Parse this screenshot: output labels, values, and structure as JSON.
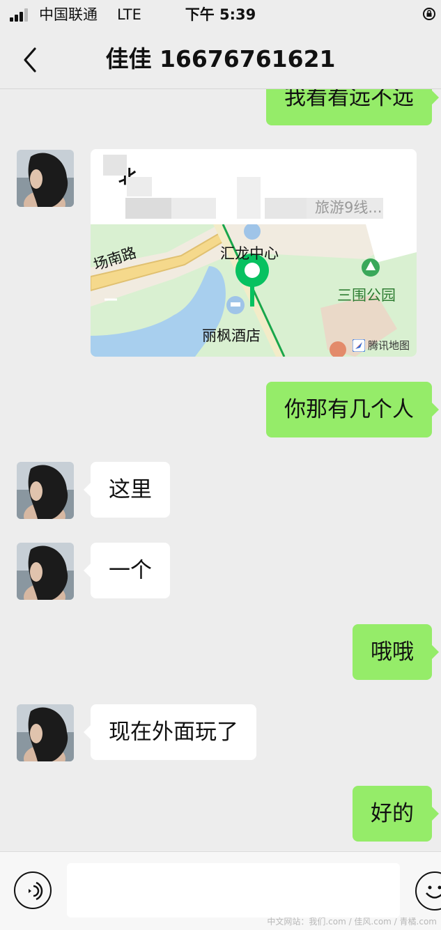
{
  "status_bar": {
    "carrier": "中国联通",
    "network": "LTE",
    "time": "下午 5:39"
  },
  "header": {
    "title": "佳佳 16676761621",
    "back_icon": "chevron-left-icon"
  },
  "messages": {
    "m1": {
      "side": "out",
      "text": "我看看远不远"
    },
    "location": {
      "side": "in",
      "title_visible": "北",
      "subtitle_visible": "旅游9线...",
      "map": {
        "labels": {
          "road": "场南路",
          "center": "汇龙中心",
          "park": "三围公园",
          "hotel": "丽枫酒店"
        },
        "attribution": "腾讯地图",
        "pin_color": "#07c160"
      }
    },
    "m3": {
      "side": "out",
      "text": "你那有几个人"
    },
    "m4": {
      "side": "in",
      "text": "这里"
    },
    "m5": {
      "side": "in",
      "text": "一个"
    },
    "m6": {
      "side": "out",
      "text": "哦哦"
    },
    "m7": {
      "side": "in",
      "text": "现在外面玩了"
    },
    "m8": {
      "side": "out",
      "text": "好的"
    }
  },
  "input_bar": {
    "voice_icon": "voice-icon",
    "emoji_icon": "emoji-icon",
    "message_value": ""
  },
  "watermark": "中文网站：我们.com / 佳风.com / 青橘.com",
  "colors": {
    "outgoing_bubble": "#95ec69",
    "incoming_bubble": "#ffffff",
    "background": "#ededed"
  }
}
